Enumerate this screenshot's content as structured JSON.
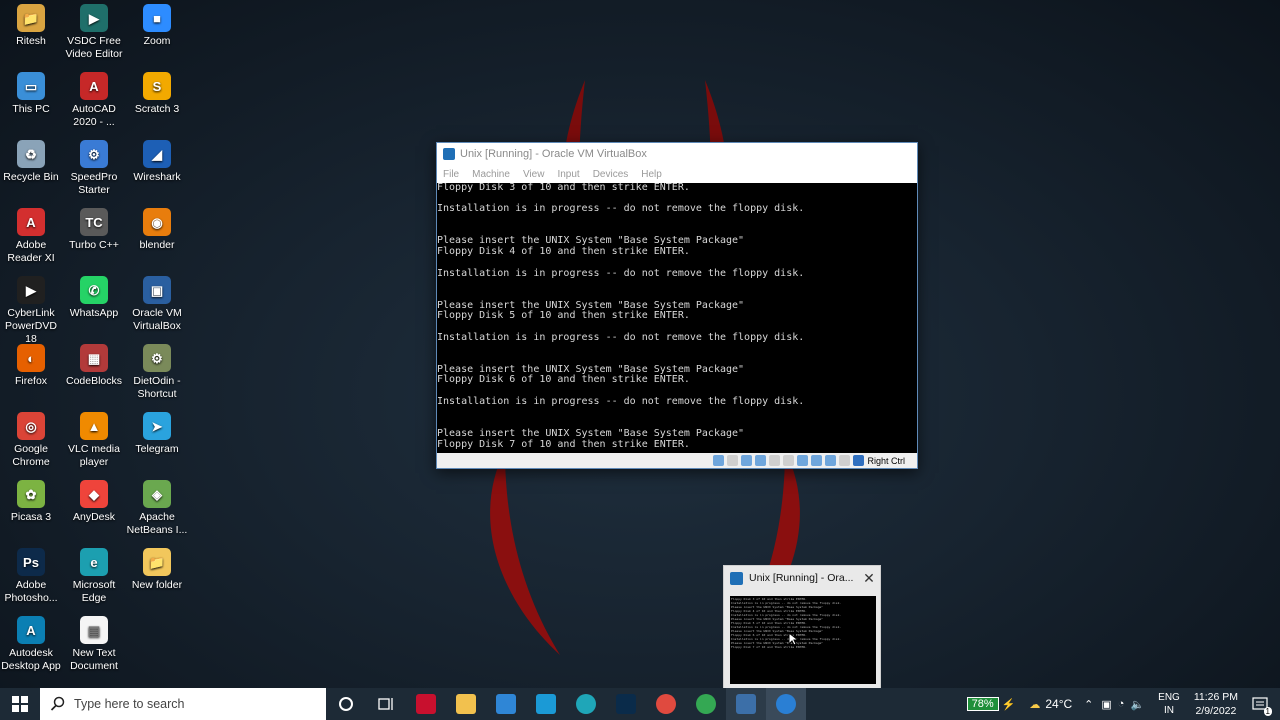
{
  "desktop_icons": [
    {
      "label": "Ritesh",
      "color": "#d9a441",
      "glyph": "📁"
    },
    {
      "label": "VSDC Free Video Editor",
      "color": "#1f6f6a",
      "glyph": "▶"
    },
    {
      "label": "Zoom",
      "color": "#2d8cff",
      "glyph": "■"
    },
    {
      "label": "This PC",
      "color": "#3a8fd8",
      "glyph": "▭"
    },
    {
      "label": "AutoCAD 2020 - ...",
      "color": "#c62828",
      "glyph": "A"
    },
    {
      "label": "Scratch 3",
      "color": "#f2a900",
      "glyph": "S"
    },
    {
      "label": "Recycle Bin",
      "color": "#8aa3b8",
      "glyph": "♻"
    },
    {
      "label": "SpeedPro Starter",
      "color": "#3a7bd5",
      "glyph": "⚙"
    },
    {
      "label": "Wireshark",
      "color": "#1d5fb5",
      "glyph": "◢"
    },
    {
      "label": "Adobe Reader XI",
      "color": "#d32f2f",
      "glyph": "A"
    },
    {
      "label": "Turbo C++",
      "color": "#5a5a5a",
      "glyph": "TC"
    },
    {
      "label": "blender",
      "color": "#e87d0d",
      "glyph": "◉"
    },
    {
      "label": "CyberLink PowerDVD 18",
      "color": "#202020",
      "glyph": "▶"
    },
    {
      "label": "WhatsApp",
      "color": "#25d366",
      "glyph": "✆"
    },
    {
      "label": "Oracle VM VirtualBox",
      "color": "#2a5fa0",
      "glyph": "▣"
    },
    {
      "label": "Firefox",
      "color": "#e66000",
      "glyph": "◐"
    },
    {
      "label": "CodeBlocks",
      "color": "#b23a3a",
      "glyph": "▦"
    },
    {
      "label": "DietOdin - Shortcut",
      "color": "#7a8a5a",
      "glyph": "⚙"
    },
    {
      "label": "Google Chrome",
      "color": "#db4437",
      "glyph": "◎"
    },
    {
      "label": "VLC media player",
      "color": "#f08a00",
      "glyph": "▲"
    },
    {
      "label": "Telegram",
      "color": "#2aa3de",
      "glyph": "➤"
    },
    {
      "label": "Picasa 3",
      "color": "#7cb342",
      "glyph": "✿"
    },
    {
      "label": "AnyDesk",
      "color": "#ef443b",
      "glyph": "◆"
    },
    {
      "label": "Apache NetBeans I...",
      "color": "#6aa84f",
      "glyph": "◈"
    },
    {
      "label": "Adobe Photosho...",
      "color": "#0d2a4a",
      "glyph": "Ps"
    },
    {
      "label": "Microsoft Edge",
      "color": "#1c9fb0",
      "glyph": "e"
    },
    {
      "label": "New folder",
      "color": "#f2c75c",
      "glyph": "📁"
    },
    {
      "label": "Autodesk Desktop App",
      "color": "#0b7fb3",
      "glyph": "A"
    },
    {
      "label": "New Text Document",
      "color": "#f5f5f5",
      "glyph": "▤"
    }
  ],
  "vbox": {
    "title": "Unix [Running] - Oracle VM VirtualBox",
    "menu": [
      "File",
      "Machine",
      "View",
      "Input",
      "Devices",
      "Help"
    ],
    "console_lines": [
      "Floppy Disk 3 of 10 and then strike ENTER.",
      "",
      "Installation is in progress -- do not remove the floppy disk.",
      "",
      "",
      "Please insert the UNIX System \"Base System Package\"",
      "Floppy Disk 4 of 10 and then strike ENTER.",
      "",
      "Installation is in progress -- do not remove the floppy disk.",
      "",
      "",
      "Please insert the UNIX System \"Base System Package\"",
      "Floppy Disk 5 of 10 and then strike ENTER.",
      "",
      "Installation is in progress -- do not remove the floppy disk.",
      "",
      "",
      "Please insert the UNIX System \"Base System Package\"",
      "Floppy Disk 6 of 10 and then strike ENTER.",
      "",
      "Installation is in progress -- do not remove the floppy disk.",
      "",
      "",
      "Please insert the UNIX System \"Base System Package\"",
      "Floppy Disk 7 of 10 and then strike ENTER."
    ],
    "host_key": "Right Ctrl"
  },
  "preview": {
    "title": "Unix [Running] - Ora...",
    "close": "✕"
  },
  "taskbar": {
    "search_placeholder": "Type here to search",
    "battery": "78%",
    "weather": "24°C",
    "language": "ENG",
    "region": "IN",
    "time": "11:26 PM",
    "date": "2/9/2022",
    "notifications": "1"
  }
}
